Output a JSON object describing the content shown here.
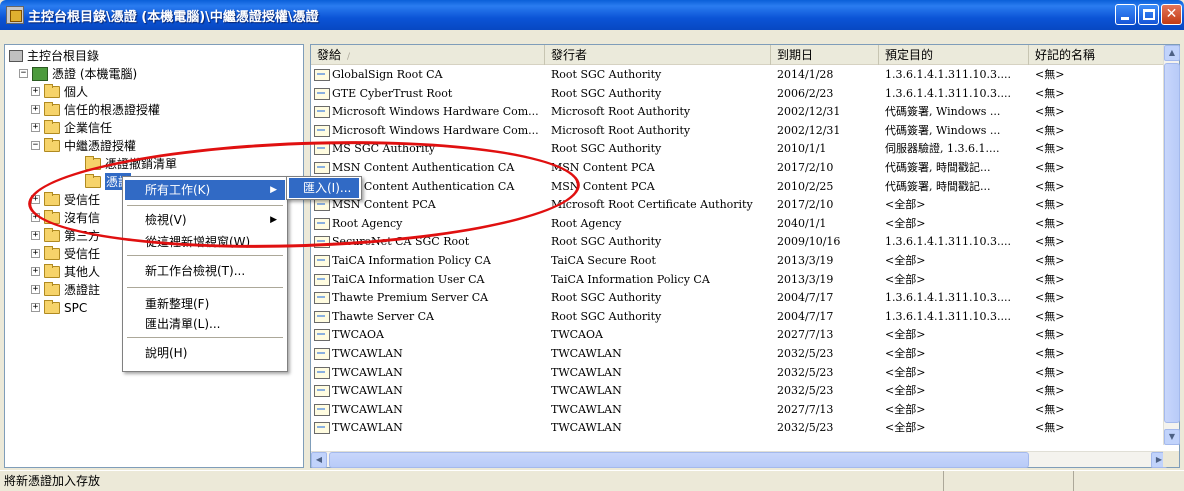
{
  "window": {
    "title": "主控台根目錄\\憑證 (本機電腦)\\中繼憑證授權\\憑證"
  },
  "tree": [
    {
      "label": "主控台根目錄",
      "indent": 0,
      "expander": "",
      "icon": "root"
    },
    {
      "label": "憑證 (本機電腦)",
      "indent": 1,
      "expander": "−",
      "icon": "store"
    },
    {
      "label": "個人",
      "indent": 2,
      "expander": "+",
      "icon": "folder"
    },
    {
      "label": "信任的根憑證授權",
      "indent": 2,
      "expander": "+",
      "icon": "folder"
    },
    {
      "label": "企業信任",
      "indent": 2,
      "expander": "+",
      "icon": "folder"
    },
    {
      "label": "中繼憑證授權",
      "indent": 2,
      "expander": "−",
      "icon": "folder"
    },
    {
      "label": "憑證撤銷清單",
      "indent": 3,
      "expander": "",
      "icon": "folder"
    },
    {
      "label": "憑證",
      "indent": 3,
      "expander": "",
      "icon": "folder",
      "selected": true
    },
    {
      "label": "受信任",
      "indent": 2,
      "expander": "+",
      "icon": "folder"
    },
    {
      "label": "沒有信",
      "indent": 2,
      "expander": "+",
      "icon": "folder"
    },
    {
      "label": "第三方",
      "indent": 2,
      "expander": "+",
      "icon": "folder"
    },
    {
      "label": "受信任",
      "indent": 2,
      "expander": "+",
      "icon": "folder"
    },
    {
      "label": "其他人",
      "indent": 2,
      "expander": "+",
      "icon": "folder"
    },
    {
      "label": "憑證註",
      "indent": 2,
      "expander": "+",
      "icon": "folder"
    },
    {
      "label": "SPC",
      "indent": 2,
      "expander": "+",
      "icon": "folder"
    }
  ],
  "columns": [
    "發給",
    "發行者",
    "到期日",
    "預定目的",
    "好記的名稱"
  ],
  "rows": [
    [
      "GlobalSign Root CA",
      "Root SGC Authority",
      "2014/1/28",
      "1.3.6.1.4.1.311.10.3....",
      "<無>"
    ],
    [
      "GTE CyberTrust Root",
      "Root SGC Authority",
      "2006/2/23",
      "1.3.6.1.4.1.311.10.3....",
      "<無>"
    ],
    [
      "Microsoft Windows Hardware Com...",
      "Microsoft Root Authority",
      "2002/12/31",
      "代碼簽署, Windows ...",
      "<無>"
    ],
    [
      "Microsoft Windows Hardware Com...",
      "Microsoft Root Authority",
      "2002/12/31",
      "代碼簽署, Windows ...",
      "<無>"
    ],
    [
      "MS SGC Authority",
      "Root SGC Authority",
      "2010/1/1",
      "伺服器驗證, 1.3.6.1....",
      "<無>"
    ],
    [
      "MSN Content Authentication CA",
      "MSN Content PCA",
      "2017/2/10",
      "代碼簽署, 時間戳記...",
      "<無>"
    ],
    [
      "MSN Content Authentication CA",
      "MSN Content PCA",
      "2010/2/25",
      "代碼簽署, 時間戳記...",
      "<無>"
    ],
    [
      "MSN Content PCA",
      "Microsoft Root Certificate Authority",
      "2017/2/10",
      "<全部>",
      "<無>"
    ],
    [
      "Root Agency",
      "Root Agency",
      "2040/1/1",
      "<全部>",
      "<無>"
    ],
    [
      "SecureNet CA SGC Root",
      "Root SGC Authority",
      "2009/10/16",
      "1.3.6.1.4.1.311.10.3....",
      "<無>"
    ],
    [
      "TaiCA Information Policy CA",
      "TaiCA Secure Root",
      "2013/3/19",
      "<全部>",
      "<無>"
    ],
    [
      "TaiCA Information User CA",
      "TaiCA Information Policy CA",
      "2013/3/19",
      "<全部>",
      "<無>"
    ],
    [
      "Thawte Premium Server CA",
      "Root SGC Authority",
      "2004/7/17",
      "1.3.6.1.4.1.311.10.3....",
      "<無>"
    ],
    [
      "Thawte Server CA",
      "Root SGC Authority",
      "2004/7/17",
      "1.3.6.1.4.1.311.10.3....",
      "<無>"
    ],
    [
      "TWCAOA",
      "TWCAOA",
      "2027/7/13",
      "<全部>",
      "<無>"
    ],
    [
      "TWCAWLAN",
      "TWCAWLAN",
      "2032/5/23",
      "<全部>",
      "<無>"
    ],
    [
      "TWCAWLAN",
      "TWCAWLAN",
      "2032/5/23",
      "<全部>",
      "<無>"
    ],
    [
      "TWCAWLAN",
      "TWCAWLAN",
      "2032/5/23",
      "<全部>",
      "<無>"
    ],
    [
      "TWCAWLAN",
      "TWCAWLAN",
      "2027/7/13",
      "<全部>",
      "<無>"
    ],
    [
      "TWCAWLAN",
      "TWCAWLAN",
      "2032/5/23",
      "<全部>",
      "<無>"
    ]
  ],
  "context_menu": {
    "items": [
      {
        "label": "所有工作(K)",
        "submenu": true,
        "highlighted": true
      },
      {
        "label": "檢視(V)",
        "submenu": true
      },
      {
        "label": "從這裡新增視窗(W)"
      },
      {
        "label": "新工作台檢視(T)..."
      },
      {
        "label": "重新整理(F)"
      },
      {
        "label": "匯出清單(L)..."
      },
      {
        "label": "說明(H)"
      }
    ],
    "submenu_item": "匯入(I)..."
  },
  "status": {
    "text": "將新憑證加入存放"
  },
  "colors": {
    "annotation": "#e01010",
    "highlight": "#316ac5"
  }
}
